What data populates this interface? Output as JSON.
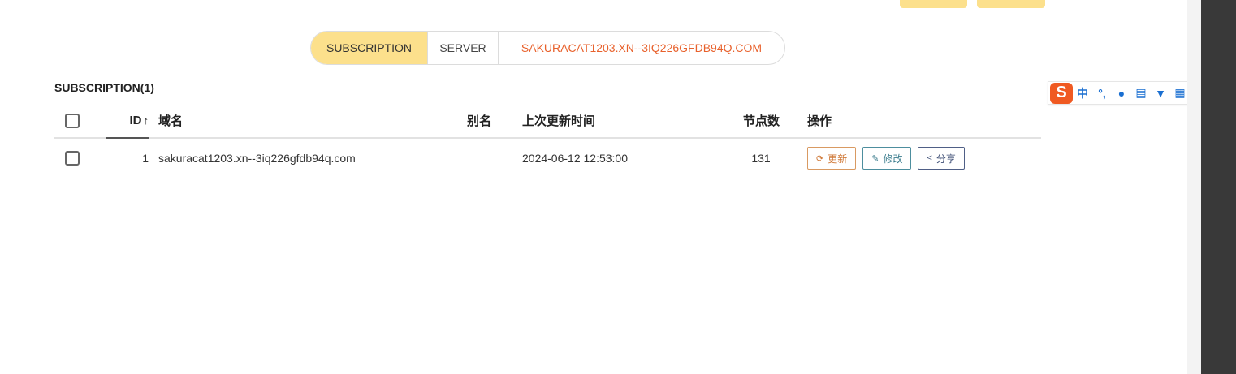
{
  "top_buttons": [
    {
      "label": ""
    },
    {
      "label": ""
    }
  ],
  "segments": [
    {
      "label": "SUBSCRIPTION",
      "active": true
    },
    {
      "label": "SERVER",
      "active": false
    },
    {
      "label": "SAKURACAT1203.XN--3IQ226GFDB94Q.COM",
      "active": false
    }
  ],
  "section_title": "SUBSCRIPTION(1)",
  "table": {
    "headers": {
      "id": "ID",
      "sort_indicator": "↑",
      "domain": "域名",
      "alias": "别名",
      "last_update": "上次更新时间",
      "nodes": "节点数",
      "actions": "操作"
    },
    "rows": [
      {
        "id": "1",
        "domain": "sakuracat1203.xn--3iq226gfdb94q.com",
        "alias": "",
        "last_update": "2024-06-12 12:53:00",
        "nodes": "131",
        "actions": {
          "update": "更新",
          "edit": "修改",
          "share": "分享"
        }
      }
    ]
  },
  "ime_toolbar": {
    "logo": "S",
    "items": [
      {
        "icon": "chinese-mode-icon",
        "glyph": "中"
      },
      {
        "icon": "punctuation-icon",
        "glyph": "°,"
      },
      {
        "icon": "microphone-icon",
        "glyph": "🎤"
      },
      {
        "icon": "keyboard-icon",
        "glyph": "⌨"
      },
      {
        "icon": "skin-icon",
        "glyph": "👕"
      },
      {
        "icon": "apps-icon",
        "glyph": "▦"
      },
      {
        "icon": "tool-icon",
        "glyph": "✎"
      }
    ]
  },
  "colors": {
    "accent_yellow": "#fce08c",
    "domain_orange": "#e8612c",
    "update_btn": "#d07a3a",
    "edit_btn": "#3c7d8e",
    "share_btn": "#3f4f76",
    "sidebar_dark": "#393939"
  }
}
